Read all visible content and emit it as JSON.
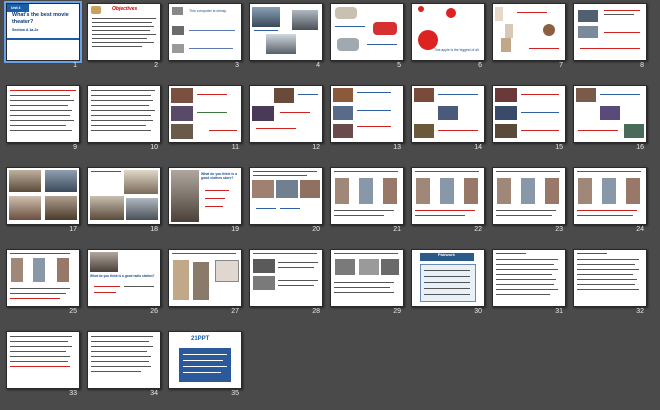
{
  "slides": [
    {
      "n": "1",
      "title": "What's the best movie theater?",
      "unit": "Unit 4",
      "section": "Section A 1a-2c"
    },
    {
      "n": "2",
      "heading": "Objectives"
    },
    {
      "n": "3",
      "caption": "This computer is cheap."
    },
    {
      "n": "4"
    },
    {
      "n": "5"
    },
    {
      "n": "6",
      "caption": "This apple is the biggest of all."
    },
    {
      "n": "7"
    },
    {
      "n": "8"
    },
    {
      "n": "9"
    },
    {
      "n": "10"
    },
    {
      "n": "11"
    },
    {
      "n": "12"
    },
    {
      "n": "13"
    },
    {
      "n": "14"
    },
    {
      "n": "15"
    },
    {
      "n": "16"
    },
    {
      "n": "17",
      "heading": "What do you think is a good clothes store?"
    },
    {
      "n": "18"
    },
    {
      "n": "19"
    },
    {
      "n": "20"
    },
    {
      "n": "21"
    },
    {
      "n": "22"
    },
    {
      "n": "23",
      "heading": "What do you think is a good radio station?"
    },
    {
      "n": "24"
    },
    {
      "n": "25"
    },
    {
      "n": "26"
    },
    {
      "n": "27",
      "heading": "Pairwork"
    },
    {
      "n": "28"
    },
    {
      "n": "29"
    },
    {
      "n": "30"
    },
    {
      "n": "31",
      "heading": "21PPT"
    }
  ],
  "colors": {
    "background": "#4a4a4a",
    "accent": "#1a4d8c",
    "highlight": "#c22222"
  }
}
